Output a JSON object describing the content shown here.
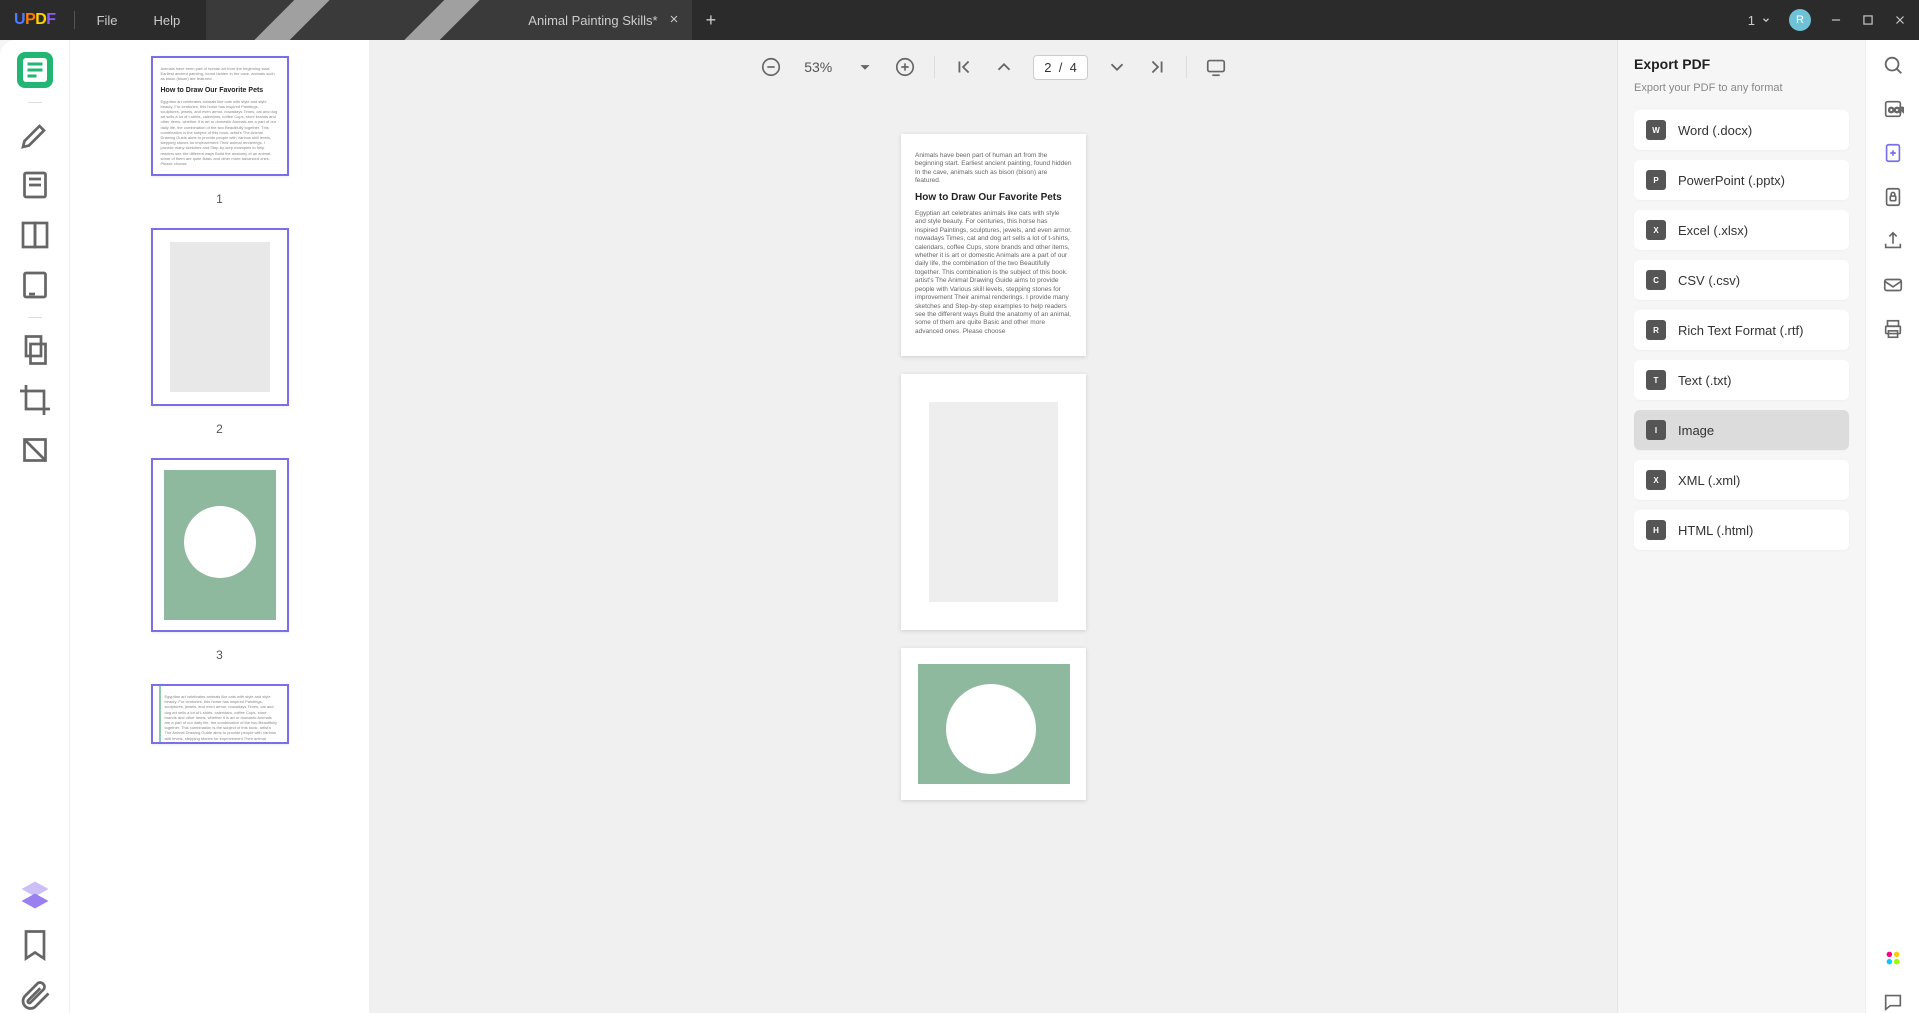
{
  "titlebar": {
    "logo_u": "U",
    "logo_p": "P",
    "logo_d": "D",
    "logo_f": "F",
    "file": "File",
    "help": "Help",
    "tab_title": "Animal Painting Skills*",
    "doc_count": "1",
    "avatar_initial": "R"
  },
  "toolbar": {
    "zoom": "53%",
    "page_current": "2",
    "page_sep": "/",
    "page_total": "4"
  },
  "thumbnails": {
    "p1": "1",
    "p2": "2",
    "p3": "3",
    "heading": "How to Draw Our Favorite Pets",
    "intro": "Animals have been part of human art from the beginning start. Earliest ancient painting, found hidden In the cave, animals such as bison (bison) are featured.",
    "body": "Egyptian art celebrates animals like cats with style and style beauty. For centuries, this horse has inspired Paintings, sculptures, jewels, and even armor. nowadays Times, cat and dog art sells a lot of t-shirts, calendars, coffee Cups, store brands and other items, whether it is art or domestic Animals are a part of our daily life, the combination of the two Beautifully together. This combination is the subject of this book. artist's The Animal Drawing Guide aims to provide people with Various skill levels, stepping stones for improvement Their animal renderings. I provide many sketches and Step-by-step examples to help readers see the different ways Build the anatomy of an animal, some of them are quite Basic and other more advanced ones. Please choose"
  },
  "export": {
    "title": "Export PDF",
    "subtitle": "Export your PDF to any format",
    "items": [
      {
        "label": "Word (.docx)",
        "badge": "W"
      },
      {
        "label": "PowerPoint (.pptx)",
        "badge": "P"
      },
      {
        "label": "Excel (.xlsx)",
        "badge": "X"
      },
      {
        "label": "CSV (.csv)",
        "badge": "C"
      },
      {
        "label": "Rich Text Format (.rtf)",
        "badge": "R"
      },
      {
        "label": "Text (.txt)",
        "badge": "T"
      },
      {
        "label": "Image",
        "badge": "I"
      },
      {
        "label": "XML (.xml)",
        "badge": "X"
      },
      {
        "label": "HTML (.html)",
        "badge": "H"
      }
    ]
  }
}
